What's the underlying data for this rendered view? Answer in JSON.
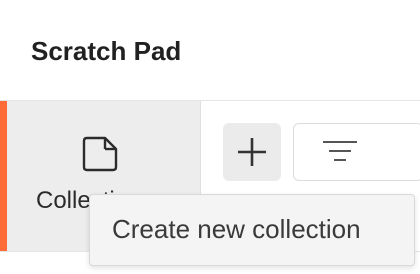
{
  "header": {
    "title": "Scratch Pad"
  },
  "sidebar": {
    "items": [
      {
        "label": "Collections",
        "icon": "collection-icon",
        "active": true
      }
    ],
    "accent_color": "#ff6c37"
  },
  "toolbar": {
    "add_icon": "plus-icon",
    "filter_icon": "filter-icon"
  },
  "tooltip": {
    "text": "Create new collection"
  }
}
